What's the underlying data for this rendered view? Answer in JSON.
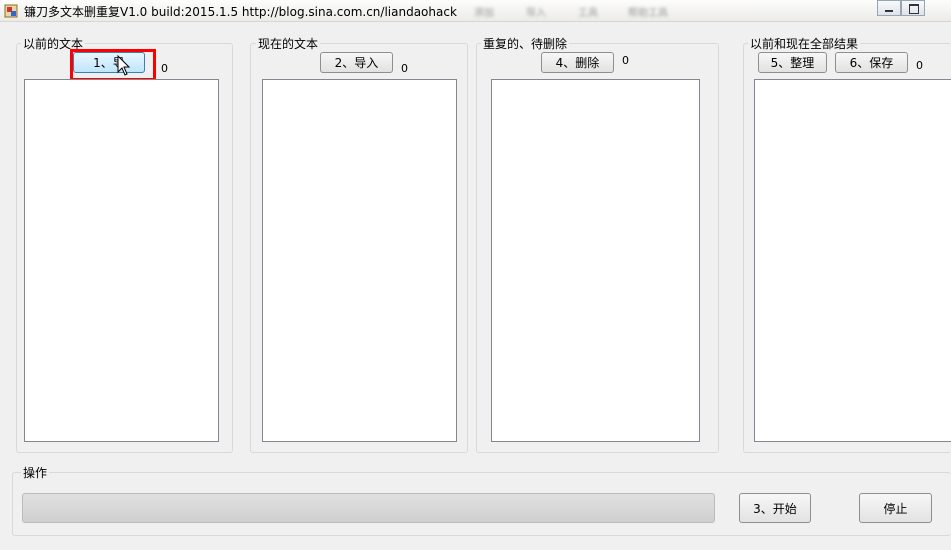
{
  "window": {
    "title": "镰刀多文本删重复V1.0  build:2015.1.5  http://blog.sina.com.cn/liandaohack",
    "menu_blurred": [
      "添加",
      "导入",
      "工具",
      "帮助工具"
    ]
  },
  "panels": {
    "previous": {
      "label": "以前的文本",
      "import_button": "1、导",
      "count": "0"
    },
    "current": {
      "label": "现在的文本",
      "import_button": "2、导入",
      "count": "0"
    },
    "duplicates": {
      "label": "重复的、待删除",
      "delete_button": "4、删除",
      "count": "0"
    },
    "results": {
      "label": "以前和现在全部结果",
      "organize_button": "5、整理",
      "save_button": "6、保存",
      "count": "0"
    }
  },
  "operation": {
    "label": "操作",
    "progress": 0,
    "start_button": "3、开始",
    "stop_button": "停止"
  },
  "colors": {
    "highlight": "#ff0000",
    "hot_button": "#bee6fd",
    "window_bg": "#f0f0f0"
  }
}
